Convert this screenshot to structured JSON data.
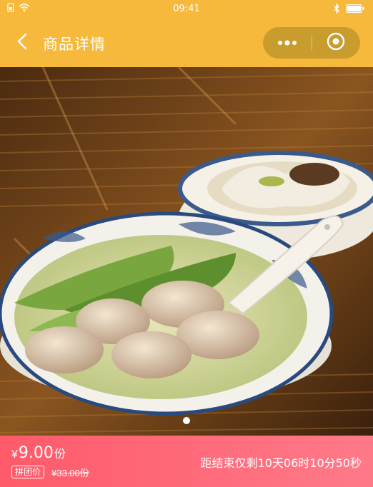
{
  "status_bar": {
    "time": "09:41",
    "left_icons": [
      "sim-icon",
      "wifi-icon"
    ],
    "right_icons": [
      "bluetooth-icon",
      "battery-icon"
    ]
  },
  "nav": {
    "title": "商品详情",
    "back_icon": "chevron-left-icon",
    "more_icon": "more-dots-icon",
    "close_icon": "target-circle-icon",
    "bg_color": "#f6b93b",
    "capsule_color": "#c99c2e"
  },
  "carousel": {
    "image_description": "fish ball soup with greens and noodle bowl",
    "slide_count": 1,
    "active_index": 0
  },
  "product": {
    "currency": "¥",
    "price": "9.00",
    "unit": "份",
    "group_badge": "拼团价",
    "original_price": "¥33.00份",
    "countdown": "距结束仅剩10天06时10分50秒",
    "bar_color_start": "#ff5a6a",
    "bar_color_end": "#ff7a89"
  }
}
